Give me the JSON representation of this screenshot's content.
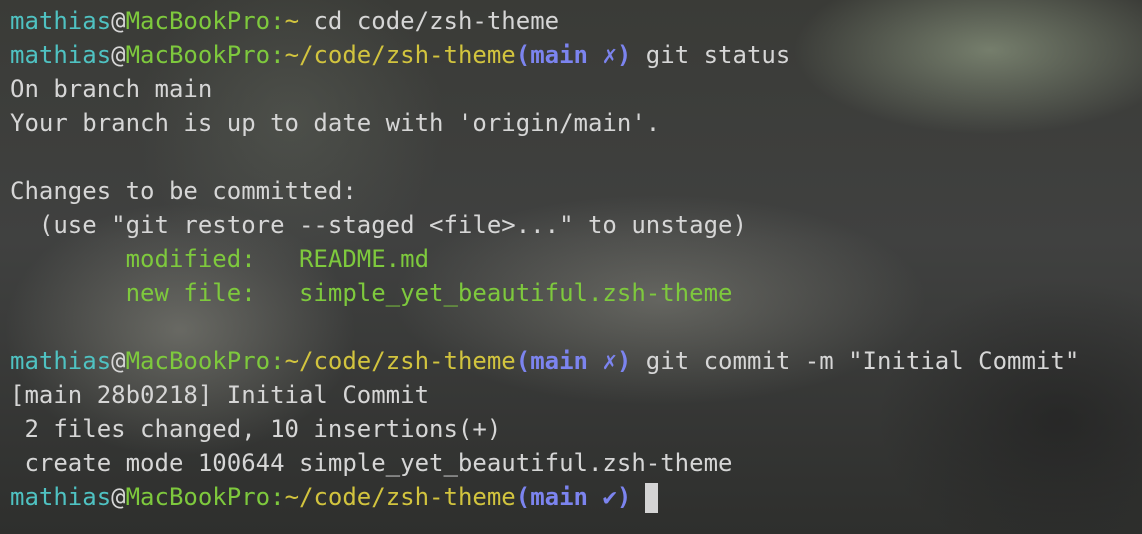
{
  "terminal": {
    "lines": [
      {
        "user": "mathias",
        "at": "@",
        "host": "MacBookPro",
        "sep": ":",
        "path": "~",
        "git": "",
        "command": "cd code/zsh-theme"
      },
      {
        "user": "mathias",
        "at": "@",
        "host": "MacBookPro",
        "sep": ":",
        "path": "~/code/zsh-theme",
        "git": "(main ✗)",
        "command": "git status"
      },
      {
        "text": "On branch main"
      },
      {
        "text": "Your branch is up to date with 'origin/main'."
      },
      {
        "text": ""
      },
      {
        "text": "Changes to be committed:"
      },
      {
        "text": "  (use \"git restore --staged <file>...\" to unstage)"
      },
      {
        "indent": "        ",
        "status": "modified:   ",
        "file": "README.md"
      },
      {
        "indent": "        ",
        "status": "new file:   ",
        "file": "simple_yet_beautiful.zsh-theme"
      },
      {
        "text": ""
      },
      {
        "user": "mathias",
        "at": "@",
        "host": "MacBookPro",
        "sep": ":",
        "path": "~/code/zsh-theme",
        "git": "(main ✗)",
        "command": "git commit -m \"Initial Commit\""
      },
      {
        "text": "[main 28b0218] Initial Commit"
      },
      {
        "text": " 2 files changed, 10 insertions(+)"
      },
      {
        "text": " create mode 100644 simple_yet_beautiful.zsh-theme"
      },
      {
        "user": "mathias",
        "at": "@",
        "host": "MacBookPro",
        "sep": ":",
        "path": "~/code/zsh-theme",
        "git": "(main ✔)",
        "command": ""
      }
    ]
  },
  "colors": {
    "user": "#4fc2c2",
    "host": "#7ec93d",
    "path": "#d2c43e",
    "git": "#7c84ef",
    "output": "#d6d6d6",
    "staged": "#7ec93d"
  }
}
